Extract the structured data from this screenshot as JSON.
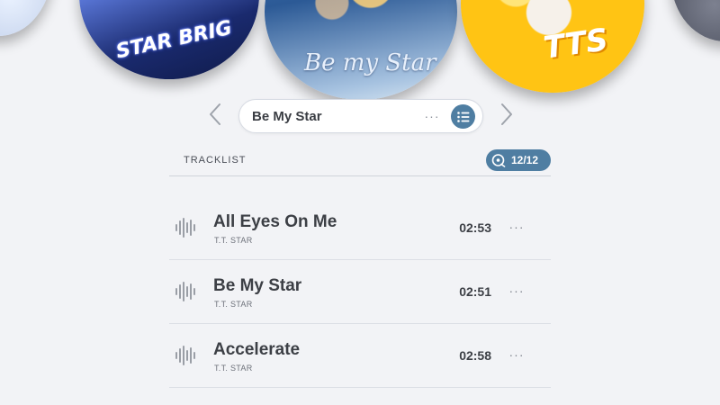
{
  "carousel": {
    "discs": [
      {
        "art_text": ""
      },
      {
        "art_text": "STAR BRIG"
      },
      {
        "art_text": "Be my Star"
      },
      {
        "art_text": "TTS"
      },
      {
        "art_text": ""
      }
    ]
  },
  "selector": {
    "album_title": "Be My Star",
    "more_label": "···"
  },
  "tracklist": {
    "label": "TRACKLIST",
    "count": "12/12",
    "tracks": [
      {
        "title": "All Eyes On Me",
        "artist": "T.T. STAR",
        "duration": "02:53"
      },
      {
        "title": "Be My Star",
        "artist": "T.T. STAR",
        "duration": "02:51"
      },
      {
        "title": "Accelerate",
        "artist": "T.T. STAR",
        "duration": "02:58"
      }
    ],
    "more_label": "···"
  },
  "colors": {
    "accent": "#4f7ea2",
    "background": "#f2f3f6",
    "text": "#3c3f45"
  },
  "icons": {
    "prev": "chevron-left-icon",
    "next": "chevron-right-icon",
    "list": "list-icon",
    "disc": "disc-icon",
    "wave": "waveform-icon"
  }
}
